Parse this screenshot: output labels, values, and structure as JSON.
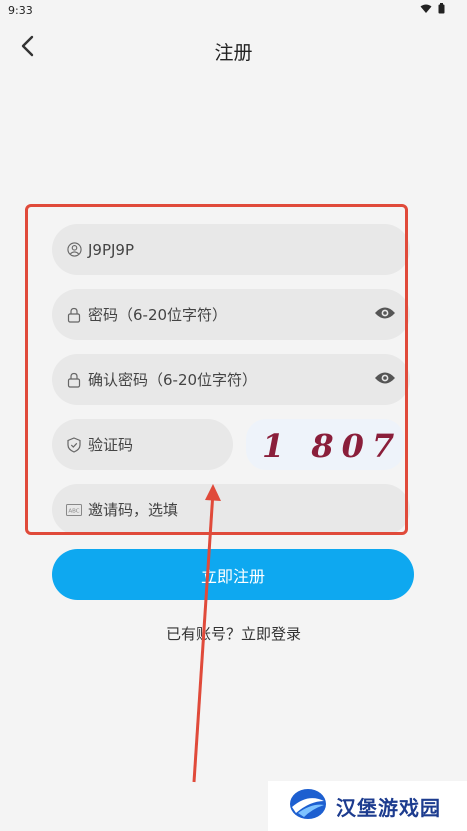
{
  "status_bar": {
    "time": "9:33"
  },
  "header": {
    "title": "注册"
  },
  "form": {
    "username_value": "J9PJ9P",
    "password_placeholder": "密码（6-20位字符）",
    "confirm_password_placeholder": "确认密码（6-20位字符）",
    "verify_code_placeholder": "验证码",
    "captcha_text": "1 807",
    "invite_code_placeholder": "邀请码，选填",
    "register_button_label": "立即注册",
    "login_prompt": "已有账号？立即登录"
  },
  "watermark": {
    "text": "汉堡游戏园"
  },
  "colors": {
    "accent": "#0ea8f0",
    "highlight": "#e04a3a",
    "captcha_text": "#8a1e3a",
    "field_bg": "#e8e8e8"
  },
  "icons": [
    "back-arrow-icon",
    "user-icon",
    "lock-icon",
    "eye-icon",
    "shield-icon",
    "invite-icon",
    "wifi-icon",
    "battery-icon"
  ]
}
